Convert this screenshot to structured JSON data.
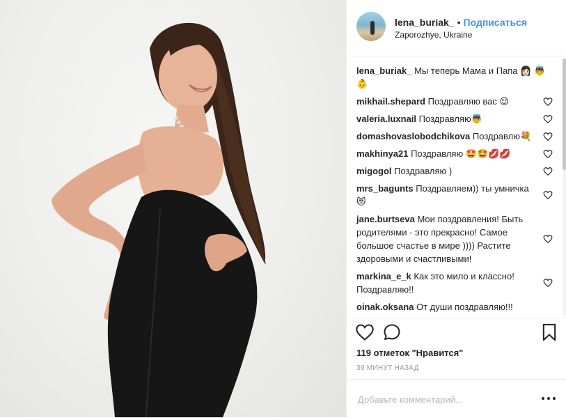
{
  "header": {
    "username": "lena_buriak_",
    "separator": "•",
    "follow_label": "Подписаться",
    "location": "Zaporozhye, Ukraine"
  },
  "caption": {
    "username": "lena_buriak_",
    "text": "Мы теперь Мама и Папа 👩🏻 👼👶"
  },
  "comments": [
    {
      "username": "mikhail.shepard",
      "text": "Поздравляю вас 😌"
    },
    {
      "username": "valeria.luxnail",
      "text": "Поздравляю👼"
    },
    {
      "username": "domashovaslobodchikova",
      "text": "Поздравлю💐"
    },
    {
      "username": "makhinya21",
      "text": "Поздравляю 🤩🤩💋💋"
    },
    {
      "username": "migogol",
      "text": "Поздравляю )"
    },
    {
      "username": "mrs_bagunts",
      "text": "Поздравляем)) ты умничка 😻"
    },
    {
      "username": "jane.burtseva",
      "text": "Мои поздравления! Быть родителями - это прекрасно! Самое большое счастье в мире )))) Растите здоровыми и счастливыми!"
    },
    {
      "username": "markina_e_k",
      "text": "Как это мило и классно! Поздравляю!!"
    },
    {
      "username": "oinak.oksana",
      "text": "От души поздравляю!!!"
    }
  ],
  "likes": "119 отметок \"Нравится\"",
  "timestamp": "39 МИНУТ НАЗАД",
  "add_comment": {
    "placeholder": "Добавьте комментарий...",
    "more_label": "..."
  },
  "icons": {
    "like": "heart-icon",
    "comment": "comment-icon",
    "save": "bookmark-icon",
    "comment_like": "small-heart-icon"
  },
  "colors": {
    "link": "#3897f0",
    "text": "#262626",
    "muted": "#999999",
    "border": "#efefef"
  }
}
